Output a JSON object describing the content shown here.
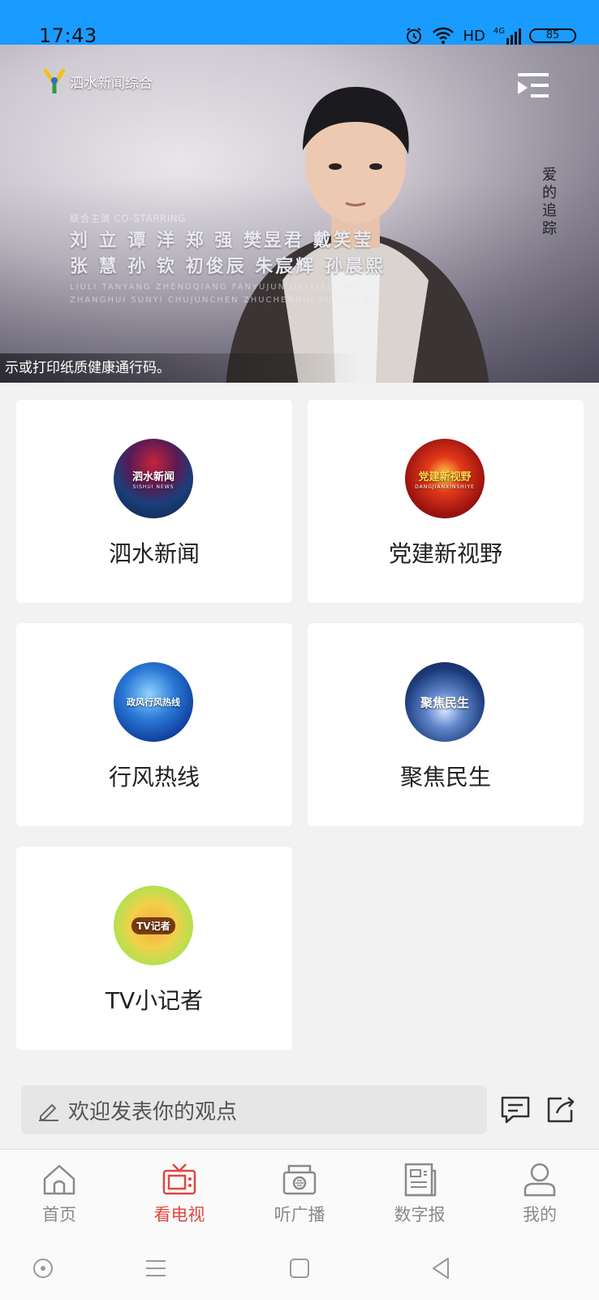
{
  "status_bar": {
    "time": "17:43",
    "network": "HD",
    "signal": "4G",
    "battery": "85"
  },
  "video": {
    "channel_logo_text": "泗水新闻综合",
    "vertical_title": "爱的追踪",
    "credits_role": "联合主演 CO-STARRING",
    "credits_line1": "刘 立  谭 洋  郑 强  樊昱君  戴笑莹",
    "credits_line2": "张 慧  孙 钦  初俊辰  朱宸辉  孙晨熙",
    "credits_pinyin1": "LIULI  TANYANG  ZHENGQIANG  FANYUJUN  DAIXIAOYING",
    "credits_pinyin2": "ZHANGHUI  SUNYI  CHUJUNCHEN  ZHUCHENHUI  SUNCHENXI",
    "ticker_text": "示或打印纸质健康通行码。"
  },
  "programs": [
    {
      "name": "泗水新闻",
      "thumb_text": "泗水新闻",
      "thumb_sub": "SISHUI NEWS",
      "icon": "sishui-news-thumbnail"
    },
    {
      "name": "党建新视野",
      "thumb_text": "党建新视野",
      "thumb_sub": "DANGJIANXINSHIYE",
      "icon": "party-building-thumbnail"
    },
    {
      "name": "行风热线",
      "thumb_text": "政风行风热线",
      "thumb_sub": "",
      "icon": "hotline-thumbnail"
    },
    {
      "name": "聚焦民生",
      "thumb_text": "聚焦民生",
      "thumb_sub": "",
      "icon": "livelihood-thumbnail"
    },
    {
      "name": "TV小记者",
      "thumb_text": "TV记者",
      "thumb_sub": "",
      "icon": "tv-reporter-thumbnail"
    }
  ],
  "comment": {
    "placeholder": "欢迎发表你的观点"
  },
  "bottom_nav": [
    {
      "label": "首页",
      "icon": "home-icon",
      "active": false
    },
    {
      "label": "看电视",
      "icon": "tv-icon",
      "active": true
    },
    {
      "label": "听广播",
      "icon": "radio-icon",
      "active": false
    },
    {
      "label": "数字报",
      "icon": "newspaper-icon",
      "active": false
    },
    {
      "label": "我的",
      "icon": "profile-icon",
      "active": false
    }
  ],
  "colors": {
    "status_bar": "#1a9bff",
    "accent": "#e0473e",
    "inactive": "#8a8a8a",
    "background": "#f2f2f2"
  }
}
